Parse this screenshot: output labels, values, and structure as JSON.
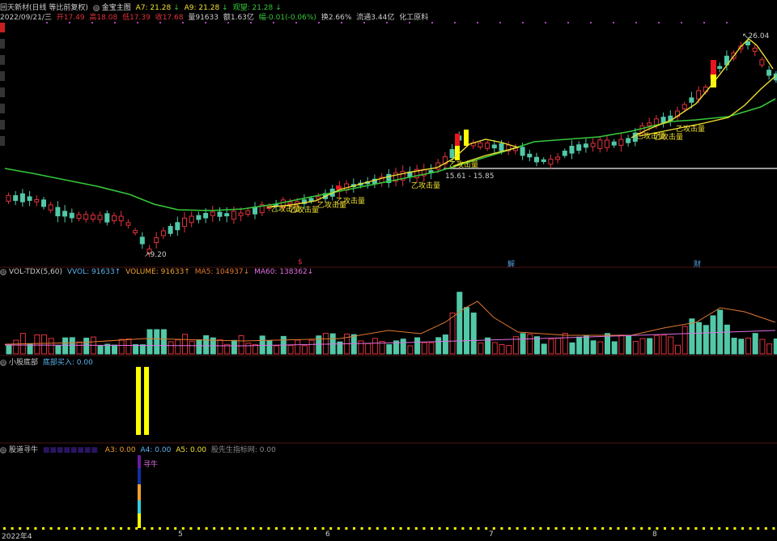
{
  "header": {
    "stock_name": "回天新材(日线 等比前复权)",
    "indicator_name": "金宝主图",
    "a7_label": "A7: 21.28",
    "a9_label": "A9: 21.28",
    "guanwang_label": "观望: 21.28",
    "date": "2022/09/21/三",
    "open": "开17.49",
    "high": "高18.08",
    "low": "低17.39",
    "close": "收17.68",
    "volume": "量91633",
    "amount": "额1.63亿",
    "change": "幅-0.01(-0.06%)",
    "turnover": "换2.66%",
    "float_cap": "流通3.44亿",
    "industry": "化工原料"
  },
  "sidebar": {
    "tabs": [
      "",
      "",
      "",
      "",
      "",
      "",
      "",
      ""
    ]
  },
  "main_chart": {
    "high_label": "26.04",
    "low_label": "9.20",
    "range_label": "15.61 - 15.85",
    "attack_label": "乙攻击量",
    "markers": [
      "$",
      "解",
      "财"
    ],
    "colors": {
      "up": "#e0323c",
      "down": "#52c8a8",
      "ma_green": "#36c83a",
      "ma_yellow": "#f0e030",
      "signal_red": "#e8141e",
      "signal_yellow": "#ffff00"
    }
  },
  "vol_panel": {
    "name": "VOL-TDX(5,60)",
    "vvol": "VVOL: 91633↑",
    "volume": "VOLUME: 91633↑",
    "ma5": "MA5: 104937↓",
    "ma60": "MA60: 138362↓"
  },
  "bottom_panel": {
    "name": "小股底部",
    "buy": "底部买入: 0.00"
  },
  "ox_panel": {
    "name": "股道寻牛",
    "a3": "A3: 0.00",
    "a4": "A4: 0.00",
    "a5": "A5: 0.00",
    "mark": "股先生指标网: 0.00",
    "seek_label": "寻牛"
  },
  "x_axis": {
    "labels": [
      "2022年4",
      "5",
      "6",
      "7",
      "8"
    ]
  }
}
